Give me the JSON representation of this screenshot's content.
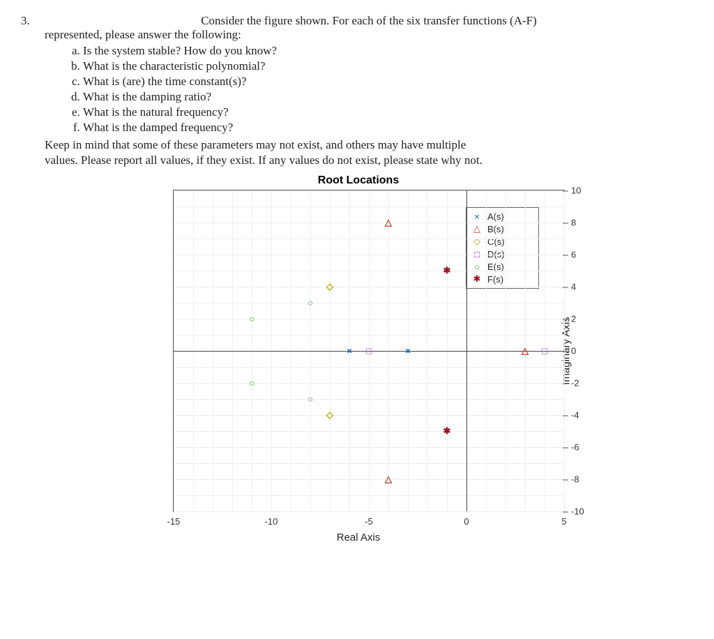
{
  "problem": {
    "number": "3.",
    "intro_line1": "Consider the figure shown.  For each of the six transfer functions (A-F)",
    "intro_line2": "represented, please answer the following:",
    "subs": [
      "Is the system stable? How do you know?",
      "What is the characteristic polynomial?",
      "What is (are) the time constant(s)?",
      "What is the damping ratio?",
      "What is the natural frequency?",
      "What is the damped frequency?"
    ],
    "note1": "Keep in mind that some of these parameters may not exist, and others may have multiple",
    "note2": "values.  Please report all values, if they exist.  If any values do not exist, please state why not."
  },
  "chart": {
    "title": "Root Locations",
    "xlabel": "Real Axis",
    "ylabel": "Imaginary Axis",
    "xticks": [
      "-15",
      "-10",
      "-5",
      "0",
      "5"
    ],
    "yticks": [
      "10",
      "8",
      "6",
      "4",
      "2",
      "0",
      "-2",
      "-4",
      "-6",
      "-8",
      "-10"
    ],
    "legend": [
      {
        "sym": "×",
        "cls": "m-x",
        "label": "A(s)"
      },
      {
        "sym": "△",
        "cls": "m-tri",
        "label": "B(s)"
      },
      {
        "sym": "◇",
        "cls": "m-dia",
        "label": "C(s)"
      },
      {
        "sym": "□",
        "cls": "m-sq",
        "label": "D(s)"
      },
      {
        "sym": "○",
        "cls": "m-circ",
        "label": "E(s)"
      },
      {
        "sym": "✱",
        "cls": "m-star",
        "label": "F(s)"
      }
    ]
  },
  "chart_data": {
    "type": "scatter",
    "title": "Root Locations",
    "xlabel": "Real Axis",
    "ylabel": "Imaginary Axis",
    "xlim": [
      -15,
      5
    ],
    "ylim": [
      -10,
      10
    ],
    "series": [
      {
        "name": "A(s)",
        "marker": "×",
        "points": [
          {
            "x": -6,
            "y": 0
          },
          {
            "x": -3,
            "y": 0
          }
        ]
      },
      {
        "name": "B(s)",
        "marker": "△",
        "points": [
          {
            "x": -4,
            "y": 8
          },
          {
            "x": -4,
            "y": -8
          },
          {
            "x": 3,
            "y": 0
          }
        ]
      },
      {
        "name": "C(s)",
        "marker": "◇",
        "points": [
          {
            "x": -7,
            "y": 4
          },
          {
            "x": -7,
            "y": -4
          }
        ]
      },
      {
        "name": "D(s)",
        "marker": "□",
        "points": [
          {
            "x": -5,
            "y": 0
          },
          {
            "x": 4,
            "y": 0
          }
        ]
      },
      {
        "name": "E(s)",
        "marker": "○",
        "points": [
          {
            "x": -11,
            "y": 2
          },
          {
            "x": -11,
            "y": -2
          },
          {
            "x": -8,
            "y": 3
          },
          {
            "x": -8,
            "y": -3
          }
        ]
      },
      {
        "name": "F(s)",
        "marker": "✱",
        "points": [
          {
            "x": -1,
            "y": 5
          },
          {
            "x": -1,
            "y": -5
          }
        ]
      }
    ]
  }
}
